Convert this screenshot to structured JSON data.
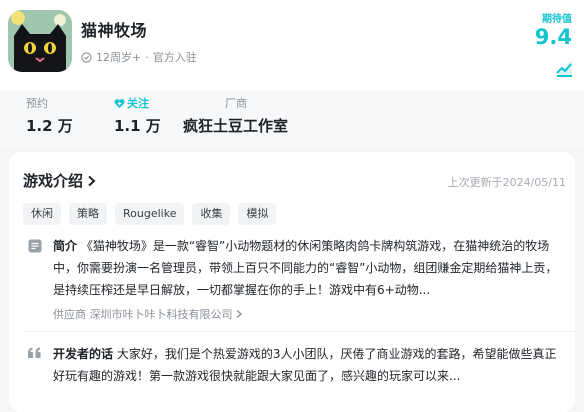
{
  "game": {
    "name": "猫神牧场",
    "age_rating": "12周岁+",
    "separator": "·",
    "official": "官方入驻",
    "rating_label": "期待值",
    "rating_value": "9.4"
  },
  "stats": {
    "reservations_label": "预约",
    "reservations_value": "1.2 万",
    "follows_label": "关注",
    "follows_value": "1.1 万",
    "developer_label": "厂商",
    "developer_value": "疯狂土豆工作室"
  },
  "intro": {
    "title": "游戏介绍",
    "updated": "上次更新于2024/05/11",
    "tags": [
      "休闲",
      "策略",
      "Rougelike",
      "收集",
      "模拟"
    ],
    "summary_label": "简介",
    "summary_text": "《猫神牧场》是一款“睿智”小动物题材的休闲策略肉鸽卡牌构筑游戏，在猫神统治的牧场中，你需要扮演一名管理员，带领上百只不同能力的“睿智”小动物，组团赚金定期给猫神上贡，是持续压榨还是早日解放，一切都掌握在你的手上！游戏中有6+动物...",
    "supplier": "供应商 深圳市咔卜咔卜科技有限公司",
    "dev_label": "开发者的话",
    "dev_text": "大家好，我们是个热爱游戏的3人小团队，厌倦了商业游戏的套路，希望能做些真正好玩有趣的游戏！第一款游戏很快就能跟大家见面了，感兴趣的玩家可以来..."
  },
  "colors": {
    "accent": "#15c5ce",
    "text": "#1f2329",
    "muted": "#8a8f99"
  }
}
